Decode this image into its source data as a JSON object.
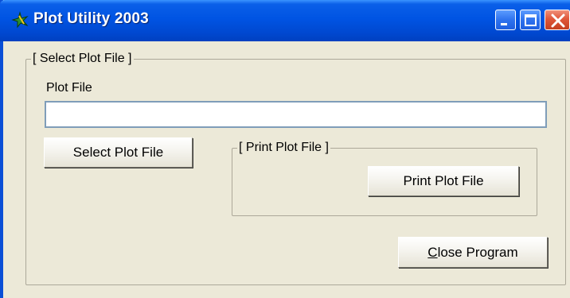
{
  "window": {
    "title": "Plot Utility 2003"
  },
  "select_group": {
    "legend": "[ Select Plot File ]",
    "field_label": "Plot File",
    "field_value": "",
    "select_button": "Select Plot File"
  },
  "print_group": {
    "legend": "[ Print Plot File ]",
    "print_button": "Print Plot File"
  },
  "close_button": {
    "mnemonic": "C",
    "rest": "lose Program"
  },
  "icons": {
    "app": "plot-utility-app-icon",
    "minimize": "minimize-icon",
    "maximize": "maximize-icon",
    "close": "close-icon"
  },
  "colors": {
    "titlebar": "#0054e3",
    "window_bg": "#ece9d8",
    "close_btn": "#e0583a"
  }
}
